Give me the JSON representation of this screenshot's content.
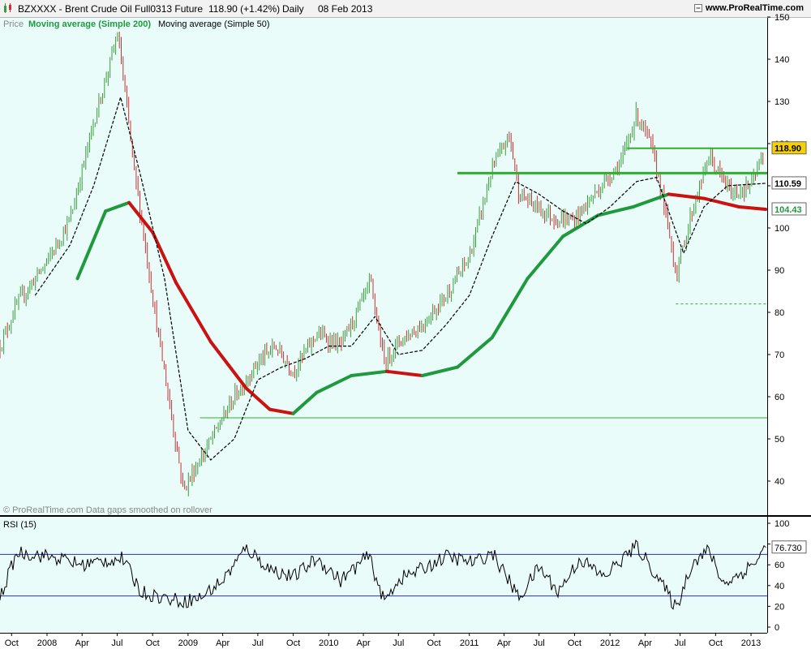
{
  "header": {
    "symbol": "BZXXXX - Brent Crude Oil Full0313 Future",
    "last_price": "118.90 (+1.42%)",
    "period": "Daily",
    "date": "08 Feb 2013",
    "website": "www.ProRealTime.com",
    "icon_names": [
      "candlestick-icon",
      "toggle-icon",
      "window-icons"
    ]
  },
  "price_panel": {
    "legend_price": "Price",
    "legend_ma200": "Moving average (Simple 200)",
    "legend_ma50": "Moving average (Simple 50)",
    "footnote": "© ProRealTime.com Data gaps smoothed on rollover",
    "y_ticks": [
      "150",
      "140",
      "130",
      "120",
      "110",
      "100",
      "90",
      "80",
      "70",
      "60",
      "50",
      "40"
    ],
    "last_price_tag": "118.90",
    "ma50_tag": "110.59",
    "ma200_tag": "104.43"
  },
  "rsi_panel": {
    "title": "RSI (15)",
    "y_ticks": [
      "100",
      "80",
      "60",
      "40",
      "20",
      "0"
    ],
    "last_tag": "76.730"
  },
  "x_axis": {
    "labels": [
      "Oct",
      "2008",
      "Apr",
      "Jul",
      "Oct",
      "2009",
      "Apr",
      "Jul",
      "Oct",
      "2010",
      "Apr",
      "Jul",
      "Oct",
      "2011",
      "Apr",
      "Jul",
      "Oct",
      "2012",
      "Apr",
      "Jul",
      "Oct",
      "2013"
    ]
  },
  "colors": {
    "up": "#3a9c3a",
    "down": "#c83232",
    "ma200_up": "#1e9a3c",
    "ma200_down": "#cc1111",
    "ma50": "#000000",
    "hline": "#2fae2f",
    "panel_bg": "#eafcfa",
    "rsi_band": "#3030a0",
    "price_tag_bg": "#f7d000"
  },
  "chart_data": [
    {
      "type": "line",
      "title": "BZXXXX - Brent Crude Oil Full0313 Future",
      "x_range": [
        "2007-09",
        "2013-02"
      ],
      "ylim": [
        35,
        150
      ],
      "grid": false,
      "legend": "top-left",
      "series": [
        {
          "name": "Price",
          "points": [
            [
              "2007-09-01",
              72
            ],
            [
              "2007-10-15",
              82
            ],
            [
              "2008-01-01",
              92
            ],
            [
              "2008-03-01",
              102
            ],
            [
              "2008-05-01",
              125
            ],
            [
              "2008-07-03",
              146
            ],
            [
              "2008-08-15",
              113
            ],
            [
              "2008-10-15",
              75
            ],
            [
              "2008-12-20",
              38
            ],
            [
              "2009-02-01",
              45
            ],
            [
              "2009-05-01",
              60
            ],
            [
              "2009-06-30",
              68
            ],
            [
              "2009-08-15",
              72
            ],
            [
              "2009-10-01",
              66
            ],
            [
              "2009-12-01",
              75
            ],
            [
              "2010-02-01",
              72
            ],
            [
              "2010-04-20",
              87
            ],
            [
              "2010-05-25",
              68
            ],
            [
              "2010-07-01",
              73
            ],
            [
              "2010-09-01",
              77
            ],
            [
              "2010-11-01",
              84
            ],
            [
              "2011-01-01",
              93
            ],
            [
              "2011-03-01",
              114
            ],
            [
              "2011-04-15",
              122
            ],
            [
              "2011-05-10",
              108
            ],
            [
              "2011-06-25",
              105
            ],
            [
              "2011-08-15",
              102
            ],
            [
              "2011-10-01",
              102
            ],
            [
              "2011-12-01",
              109
            ],
            [
              "2012-02-01",
              116
            ],
            [
              "2012-03-10",
              127
            ],
            [
              "2012-04-15",
              120
            ],
            [
              "2012-05-15",
              108
            ],
            [
              "2012-06-21",
              89
            ],
            [
              "2012-08-01",
              104
            ],
            [
              "2012-09-14",
              117
            ],
            [
              "2012-10-15",
              112
            ],
            [
              "2012-11-15",
              108
            ],
            [
              "2013-01-01",
              110
            ],
            [
              "2013-02-08",
              118.9
            ]
          ]
        },
        {
          "name": "Moving average (Simple 200)",
          "points": [
            [
              "2008-03-20",
              88
            ],
            [
              "2008-06-01",
              104
            ],
            [
              "2008-08-01",
              106
            ],
            [
              "2008-10-01",
              99
            ],
            [
              "2008-12-01",
              87
            ],
            [
              "2009-03-01",
              73
            ],
            [
              "2009-06-01",
              62
            ],
            [
              "2009-08-01",
              57
            ],
            [
              "2009-10-01",
              56
            ],
            [
              "2009-12-01",
              61
            ],
            [
              "2010-03-01",
              65
            ],
            [
              "2010-06-01",
              66
            ],
            [
              "2010-09-01",
              65
            ],
            [
              "2010-12-01",
              67
            ],
            [
              "2011-03-01",
              74
            ],
            [
              "2011-06-01",
              88
            ],
            [
              "2011-09-01",
              98
            ],
            [
              "2011-12-01",
              103
            ],
            [
              "2012-03-01",
              105
            ],
            [
              "2012-06-01",
              108
            ],
            [
              "2012-09-01",
              107
            ],
            [
              "2012-12-01",
              105
            ],
            [
              "2013-02-08",
              104.43
            ]
          ]
        },
        {
          "name": "Moving average (Simple 50)",
          "points": [
            [
              "2007-12-01",
              84
            ],
            [
              "2008-03-01",
              96
            ],
            [
              "2008-05-01",
              110
            ],
            [
              "2008-07-10",
              131
            ],
            [
              "2008-09-01",
              112
            ],
            [
              "2008-11-01",
              88
            ],
            [
              "2009-01-01",
              52
            ],
            [
              "2009-03-01",
              45
            ],
            [
              "2009-05-01",
              50
            ],
            [
              "2009-07-01",
              64
            ],
            [
              "2009-09-01",
              67
            ],
            [
              "2009-11-01",
              69
            ],
            [
              "2010-01-01",
              72
            ],
            [
              "2010-03-01",
              72
            ],
            [
              "2010-05-01",
              79
            ],
            [
              "2010-07-01",
              70
            ],
            [
              "2010-09-01",
              71
            ],
            [
              "2010-11-01",
              77
            ],
            [
              "2011-01-01",
              84
            ],
            [
              "2011-03-01",
              98
            ],
            [
              "2011-05-01",
              111
            ],
            [
              "2011-07-01",
              108
            ],
            [
              "2011-09-01",
              104
            ],
            [
              "2011-11-01",
              101
            ],
            [
              "2012-01-01",
              105
            ],
            [
              "2012-03-10",
              111
            ],
            [
              "2012-05-01",
              112
            ],
            [
              "2012-07-10",
              94
            ],
            [
              "2012-09-01",
              105
            ],
            [
              "2012-11-01",
              110
            ],
            [
              "2013-02-08",
              110.59
            ]
          ]
        }
      ],
      "horizontal_lines": [
        {
          "y": 118.9,
          "from": "2012-02-15",
          "to": "2013-02-08"
        },
        {
          "y": 113,
          "from": "2010-12-01",
          "to": "2013-02-08"
        },
        {
          "y": 82,
          "from": "2012-06-20",
          "to": "2013-02-08",
          "style": "dashed"
        },
        {
          "y": 55,
          "from": "2009-02-01",
          "to": "2013-02-08"
        }
      ]
    },
    {
      "type": "line",
      "title": "RSI (15)",
      "ylim": [
        0,
        100
      ],
      "reference_lines": [
        70,
        30
      ],
      "series": [
        {
          "name": "RSI (15)",
          "points": [
            [
              "2007-09-01",
              28
            ],
            [
              "2007-10-15",
              72
            ],
            [
              "2007-12-01",
              70
            ],
            [
              "2008-02-01",
              66
            ],
            [
              "2008-04-01",
              60
            ],
            [
              "2008-06-01",
              64
            ],
            [
              "2008-07-15",
              66
            ],
            [
              "2008-09-01",
              34
            ],
            [
              "2008-11-01",
              28
            ],
            [
              "2008-12-20",
              25
            ],
            [
              "2009-02-01",
              28
            ],
            [
              "2009-04-01",
              45
            ],
            [
              "2009-06-01",
              76
            ],
            [
              "2009-08-01",
              56
            ],
            [
              "2009-10-01",
              48
            ],
            [
              "2009-12-01",
              66
            ],
            [
              "2010-02-01",
              45
            ],
            [
              "2010-04-15",
              69
            ],
            [
              "2010-05-25",
              24
            ],
            [
              "2010-07-01",
              46
            ],
            [
              "2010-09-01",
              56
            ],
            [
              "2010-11-01",
              68
            ],
            [
              "2011-01-15",
              62
            ],
            [
              "2011-03-01",
              72
            ],
            [
              "2011-05-10",
              28
            ],
            [
              "2011-07-01",
              58
            ],
            [
              "2011-08-20",
              34
            ],
            [
              "2011-10-15",
              66
            ],
            [
              "2011-12-15",
              48
            ],
            [
              "2012-02-15",
              70
            ],
            [
              "2012-03-10",
              78
            ],
            [
              "2012-05-01",
              50
            ],
            [
              "2012-06-21",
              18
            ],
            [
              "2012-08-01",
              62
            ],
            [
              "2012-09-14",
              74
            ],
            [
              "2012-10-20",
              42
            ],
            [
              "2012-12-01",
              50
            ],
            [
              "2013-01-15",
              64
            ],
            [
              "2013-02-08",
              76.73
            ]
          ]
        }
      ]
    }
  ]
}
